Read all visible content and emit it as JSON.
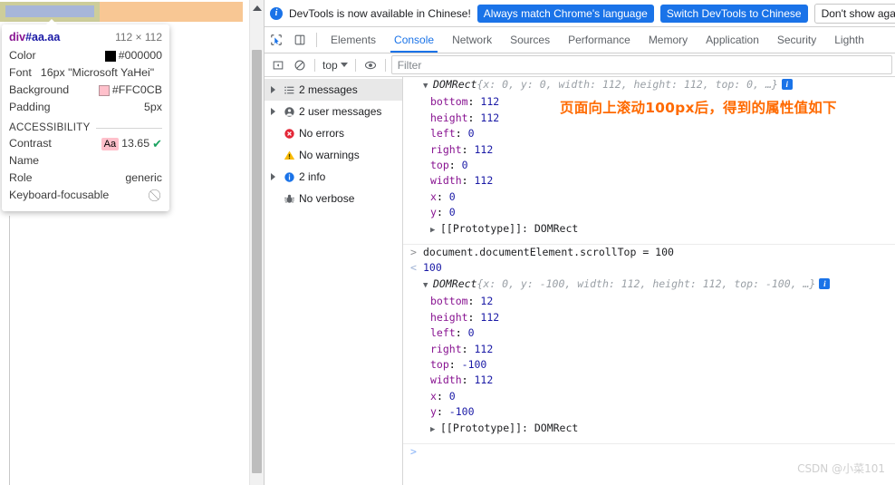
{
  "page": {
    "highlight": {
      "content_color": "#a7b6d9",
      "padding_color": "#cdcd9a",
      "margin_color": "#f8c794"
    },
    "scrollbar": {
      "up_arrow": "scrollbar-up-arrow"
    }
  },
  "inspector_tooltip": {
    "tag": "div",
    "id": "#aa",
    "class": ".aa",
    "dimensions": "112 × 112",
    "rows": [
      {
        "label": "Color",
        "value": "#000000",
        "swatch": "#000000"
      },
      {
        "label": "Font",
        "value": "16px \"Microsoft YaHei\""
      },
      {
        "label": "Background",
        "value": "#FFC0CB",
        "swatch": "#FFC0CB"
      },
      {
        "label": "Padding",
        "value": "5px"
      }
    ],
    "accessibility_label": "ACCESSIBILITY",
    "a11y": {
      "contrast_label": "Contrast",
      "contrast_chip": "Aa",
      "contrast_value": "13.65",
      "name_label": "Name",
      "name_value": "",
      "role_label": "Role",
      "role_value": "generic",
      "focusable_label": "Keyboard-focusable",
      "focusable_value": ""
    }
  },
  "notification": {
    "message": "DevTools is now available in Chinese!",
    "buttons": [
      {
        "label": "Always match Chrome's language",
        "style": "primary"
      },
      {
        "label": "Switch DevTools to Chinese",
        "style": "primary"
      },
      {
        "label": "Don't show again",
        "style": "plain"
      }
    ]
  },
  "tabs": {
    "items": [
      {
        "label": "Elements",
        "active": false
      },
      {
        "label": "Console",
        "active": true
      },
      {
        "label": "Network",
        "active": false
      },
      {
        "label": "Sources",
        "active": false
      },
      {
        "label": "Performance",
        "active": false
      },
      {
        "label": "Memory",
        "active": false
      },
      {
        "label": "Application",
        "active": false
      },
      {
        "label": "Security",
        "active": false
      },
      {
        "label": "Lighth",
        "active": false
      }
    ],
    "accent_color": "#1a73e8"
  },
  "console_toolbar": {
    "context": "top",
    "filter_placeholder": "Filter",
    "filter_value": ""
  },
  "console_sidebar": {
    "items": [
      {
        "label": "2 messages",
        "icon": "list-icon",
        "expandable": true,
        "selected": true
      },
      {
        "label": "2 user messages",
        "icon": "user-icon",
        "expandable": true,
        "selected": false
      },
      {
        "label": "No errors",
        "icon": "error-icon",
        "expandable": false,
        "selected": false
      },
      {
        "label": "No warnings",
        "icon": "warning-icon",
        "expandable": false,
        "selected": false
      },
      {
        "label": "2 info",
        "icon": "info-icon",
        "expandable": true,
        "selected": false
      },
      {
        "label": "No verbose",
        "icon": "bug-icon",
        "expandable": false,
        "selected": false
      }
    ]
  },
  "console_output": {
    "block1": {
      "preview_name": "DOMRect",
      "preview_body": "{x: 0, y: 0, width: 112, height: 112, top: 0, …}",
      "properties": [
        {
          "key": "bottom",
          "value": "112"
        },
        {
          "key": "height",
          "value": "112"
        },
        {
          "key": "left",
          "value": "0"
        },
        {
          "key": "right",
          "value": "112"
        },
        {
          "key": "top",
          "value": "0"
        },
        {
          "key": "width",
          "value": "112"
        },
        {
          "key": "x",
          "value": "0"
        },
        {
          "key": "y",
          "value": "0"
        }
      ],
      "proto": "[[Prototype]]: DOMRect"
    },
    "input_line": "document.documentElement.scrollTop = 100",
    "result_line": "100",
    "annotation": "页面向上滚动100px后，得到的属性值如下",
    "block2": {
      "preview_name": "DOMRect",
      "preview_body": "{x: 0, y: -100, width: 112, height: 112, top: -100, …}",
      "properties": [
        {
          "key": "bottom",
          "value": "12"
        },
        {
          "key": "height",
          "value": "112"
        },
        {
          "key": "left",
          "value": "0"
        },
        {
          "key": "right",
          "value": "112"
        },
        {
          "key": "top",
          "value": "-100"
        },
        {
          "key": "width",
          "value": "112"
        },
        {
          "key": "x",
          "value": "0"
        },
        {
          "key": "y",
          "value": "-100"
        }
      ],
      "proto": "[[Prototype]]: DOMRect"
    },
    "prompt_marker": ">"
  },
  "watermark": "CSDN @小菜101"
}
